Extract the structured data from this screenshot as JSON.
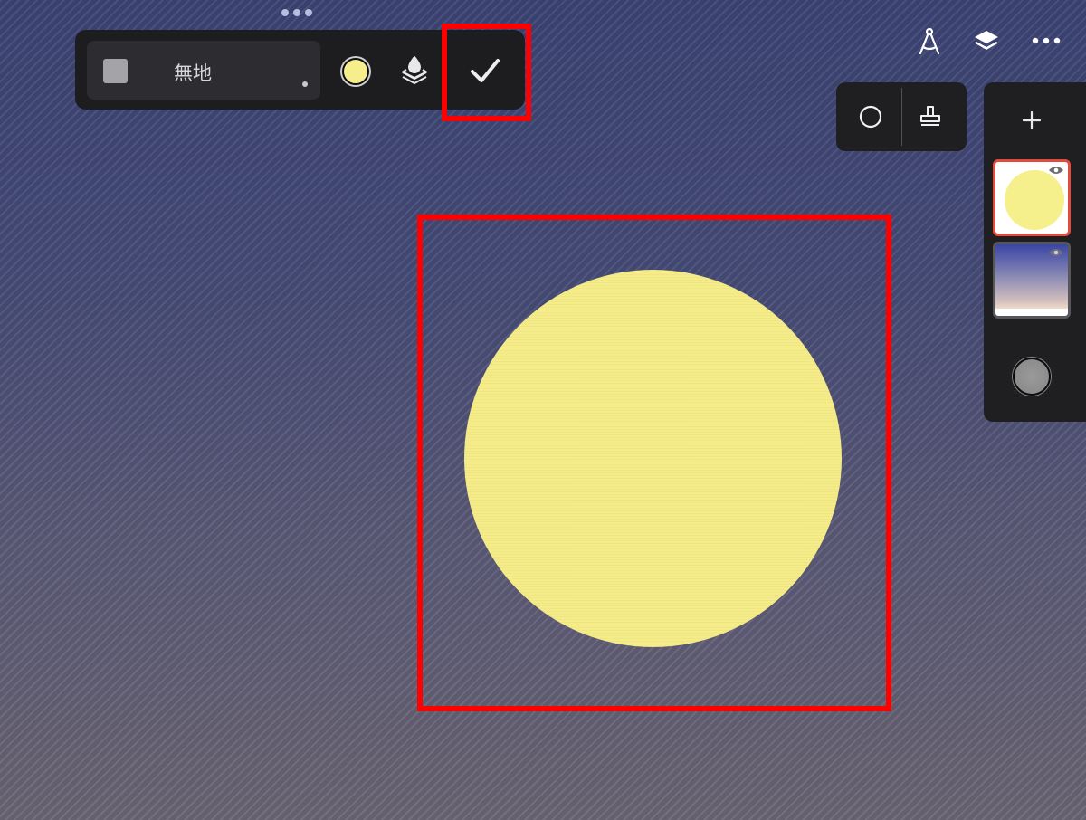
{
  "toolbar": {
    "texture_label": "無地",
    "fill_color": "#f6ee8d"
  },
  "canvas": {
    "shape": "circle",
    "shape_color": "#f5eb87"
  },
  "icons": {
    "top_right": [
      "compass-icon",
      "layers-icon",
      "more-icon"
    ],
    "shape_panel": [
      "circle-icon",
      "stamp-icon"
    ],
    "toolbar": [
      "layer-fill-icon",
      "checkmark-icon"
    ]
  },
  "layers": [
    {
      "name": "circle-layer",
      "selected": true
    },
    {
      "name": "background-gradient-layer",
      "selected": false
    }
  ],
  "highlight_color": "#ff0000"
}
